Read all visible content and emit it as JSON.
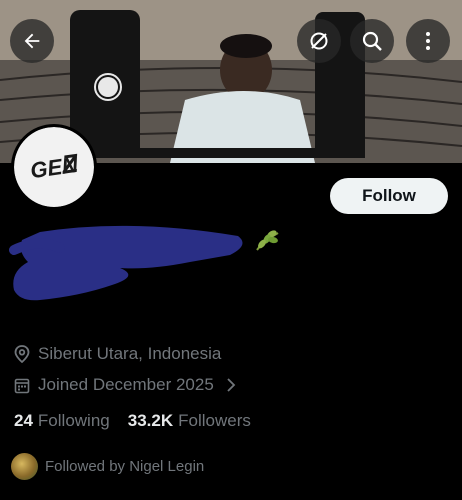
{
  "header": {
    "back_icon": "arrow-left-icon",
    "actions": [
      "no-sync-icon",
      "search-icon",
      "more-vertical-icon"
    ]
  },
  "profile": {
    "avatar_text": "GEN Z",
    "display_name": "",
    "handle": "",
    "name_emoji": "leaf-icon"
  },
  "follow_button": {
    "label": "Follow"
  },
  "meta": {
    "location": "Siberut Utara, Indonesia",
    "joined": "Joined December 2025"
  },
  "stats": {
    "following_count": "24",
    "following_label": "Following",
    "followers_count": "33.2K",
    "followers_label": "Followers"
  },
  "followed_by": "Followed by Nigel Legin",
  "colors": {
    "background": "#000000",
    "text_primary": "#e7e9ea",
    "text_secondary": "#71767b",
    "follow_bg": "#eff3f4",
    "redaction": "#2a2f86"
  }
}
